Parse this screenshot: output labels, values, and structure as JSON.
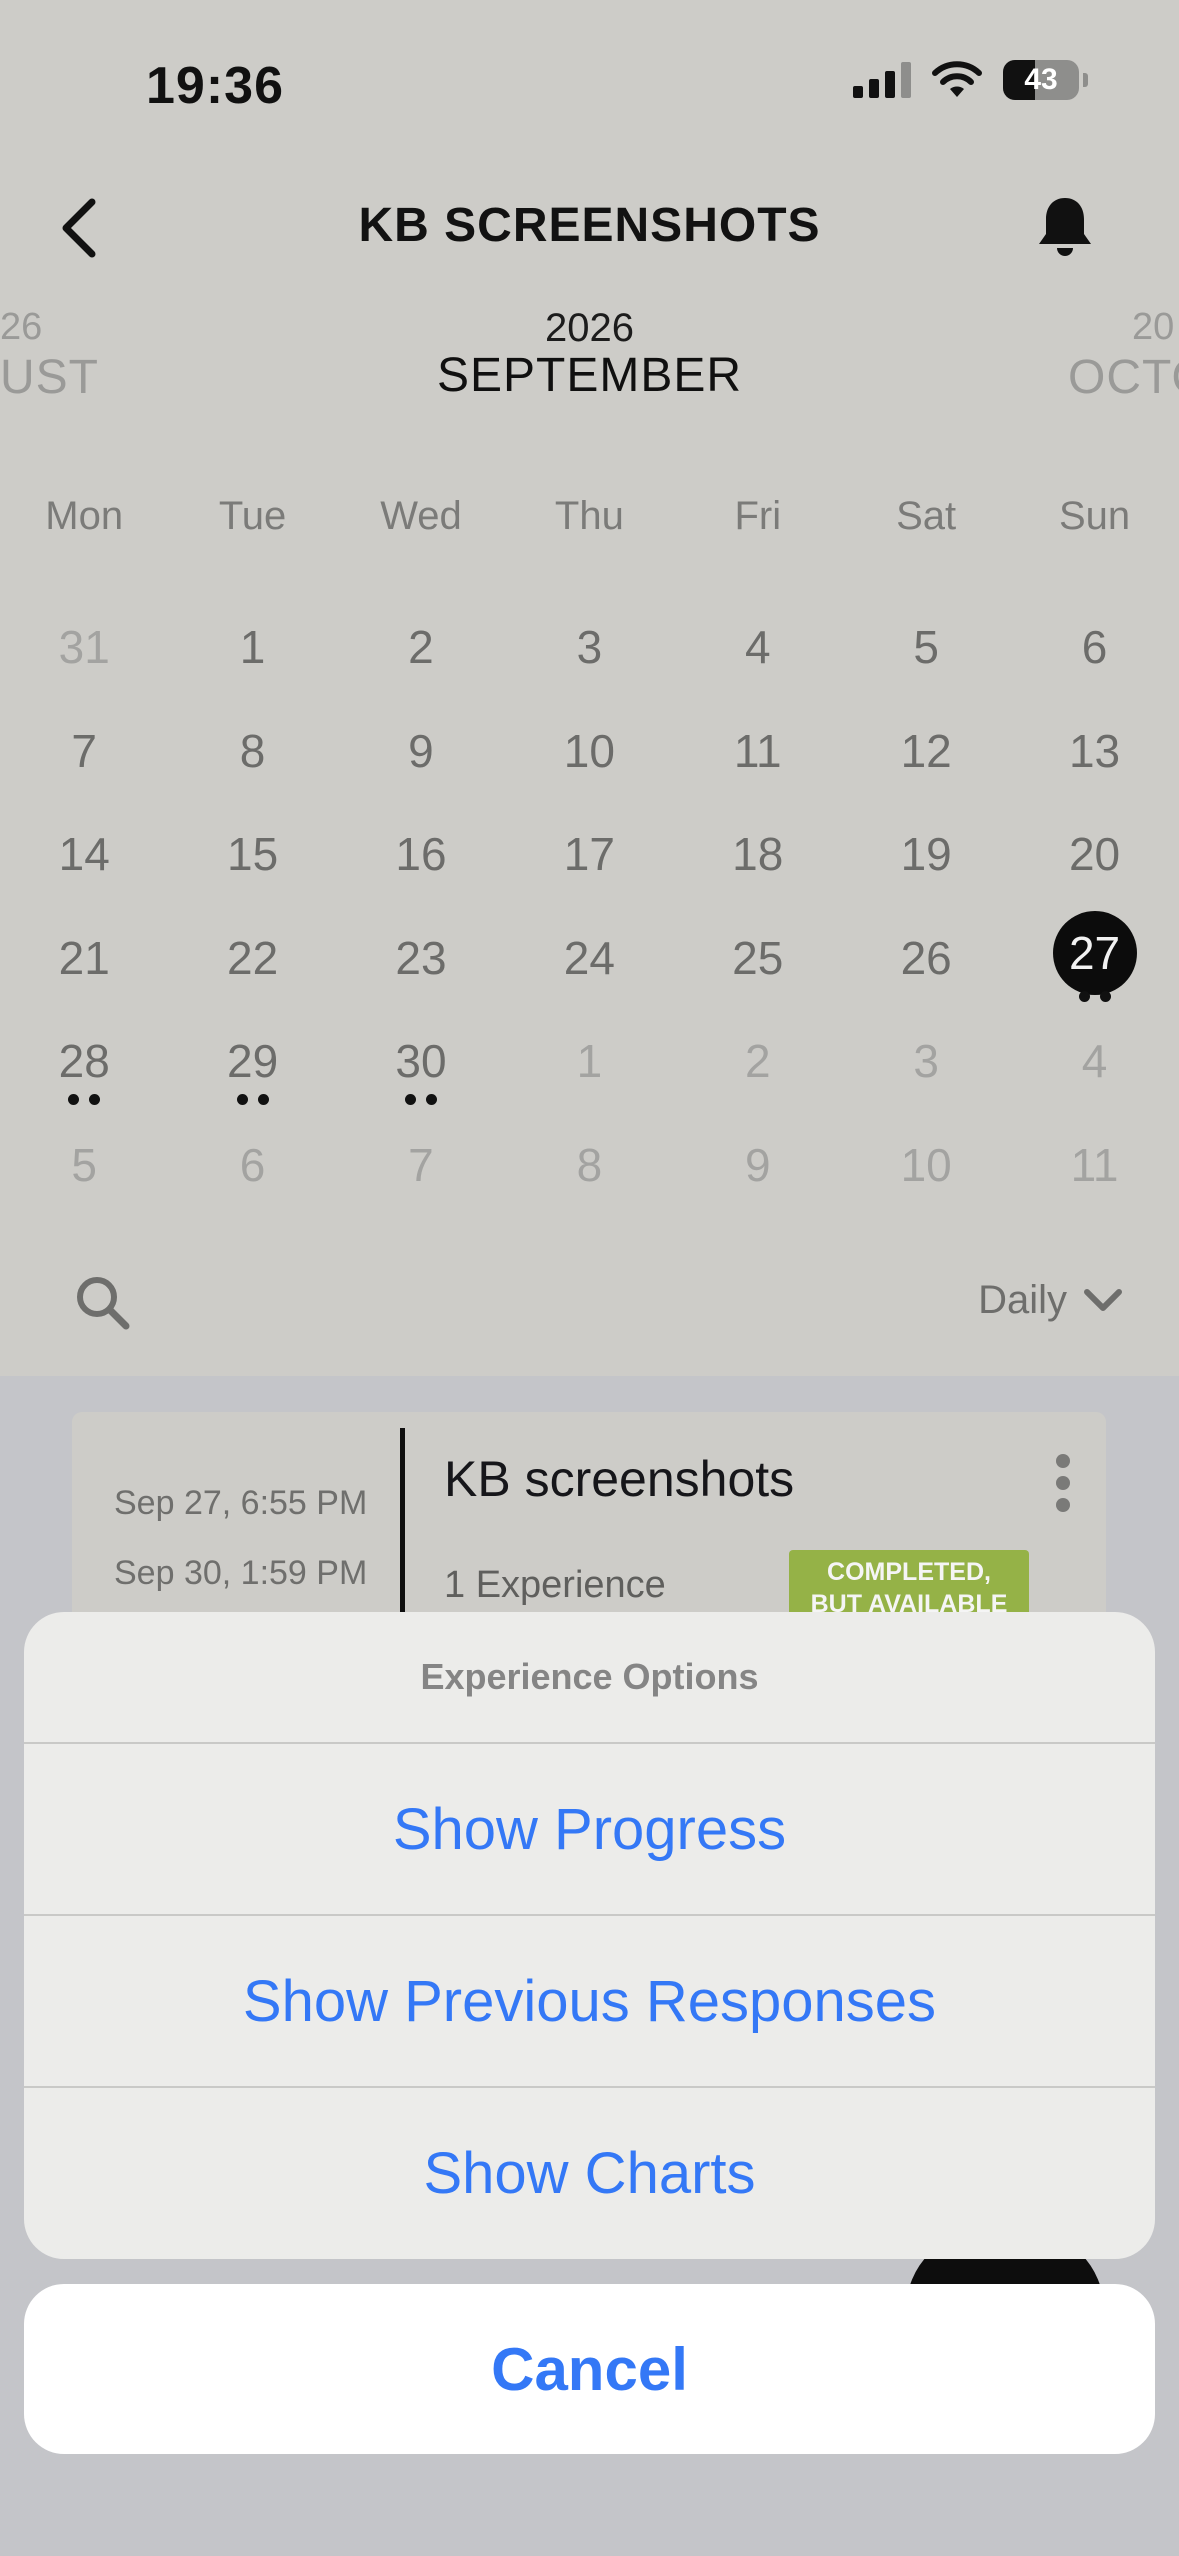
{
  "status_bar": {
    "time": "19:36",
    "battery": "43"
  },
  "header": {
    "title": "KB SCREENSHOTS"
  },
  "calendar": {
    "year": "2026",
    "month": "SEPTEMBER",
    "prev_year": "26",
    "prev_month": "UST",
    "next_year": "20",
    "next_month": "OCTO",
    "weekdays": [
      "Mon",
      "Tue",
      "Wed",
      "Thu",
      "Fri",
      "Sat",
      "Sun"
    ],
    "days": [
      {
        "n": "31",
        "other": true
      },
      {
        "n": "1"
      },
      {
        "n": "2"
      },
      {
        "n": "3"
      },
      {
        "n": "4"
      },
      {
        "n": "5"
      },
      {
        "n": "6"
      },
      {
        "n": "7"
      },
      {
        "n": "8"
      },
      {
        "n": "9"
      },
      {
        "n": "10"
      },
      {
        "n": "11"
      },
      {
        "n": "12"
      },
      {
        "n": "13"
      },
      {
        "n": "14"
      },
      {
        "n": "15"
      },
      {
        "n": "16"
      },
      {
        "n": "17"
      },
      {
        "n": "18"
      },
      {
        "n": "19"
      },
      {
        "n": "20"
      },
      {
        "n": "21"
      },
      {
        "n": "22"
      },
      {
        "n": "23"
      },
      {
        "n": "24"
      },
      {
        "n": "25"
      },
      {
        "n": "26"
      },
      {
        "n": "27",
        "selected": true,
        "dots": true
      },
      {
        "n": "28",
        "dots": true
      },
      {
        "n": "29",
        "dots": true
      },
      {
        "n": "30",
        "dots": true
      },
      {
        "n": "1",
        "other": true
      },
      {
        "n": "2",
        "other": true
      },
      {
        "n": "3",
        "other": true
      },
      {
        "n": "4",
        "other": true
      },
      {
        "n": "5",
        "other": true
      },
      {
        "n": "6",
        "other": true
      },
      {
        "n": "7",
        "other": true
      },
      {
        "n": "8",
        "other": true
      },
      {
        "n": "9",
        "other": true
      },
      {
        "n": "10",
        "other": true
      },
      {
        "n": "11",
        "other": true
      }
    ]
  },
  "toolbar": {
    "view_mode": "Daily"
  },
  "event": {
    "start": "Sep 27, 6:55 PM",
    "end": "Sep 30, 1:59 PM",
    "title": "KB screenshots",
    "count": "1 Experience",
    "badge_line1": "COMPLETED,",
    "badge_line2": "BUT AVAILABLE"
  },
  "sheet": {
    "title": "Experience Options",
    "options": [
      "Show Progress",
      "Show Previous Responses",
      "Show Charts"
    ],
    "cancel": "Cancel"
  },
  "colors": {
    "accent": "#3478f6",
    "badge": "#95b247"
  }
}
